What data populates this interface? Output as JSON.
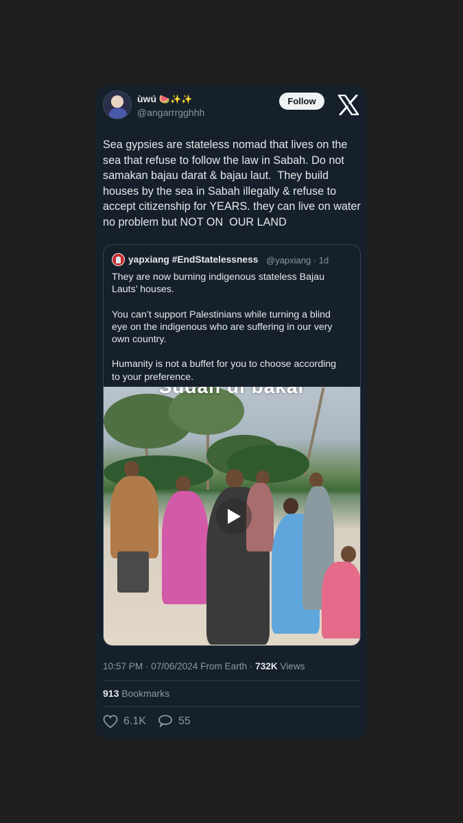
{
  "author": {
    "display_name": "ùwú",
    "display_emoji": "🍉✨✨",
    "handle": "@angarrrgghhh"
  },
  "follow_label": "Follow",
  "tweet_text": "Sea gypsies are stateless nomad that lives on the\nsea that refuse to follow the law in Sabah. Do not\nsamakan bajau darat & bajau laut.  They build\nhouses by the sea in Sabah illegally & refuse to\naccept citizenship for YEARS. they can live on water\nno problem but NOT ON  OUR LAND",
  "quoted": {
    "name": "yapxiang #EndStatelessness",
    "meta": "@yapxiang · 1d",
    "text": "They are now burning indigenous stateless Bajau\nLauts’ houses.\n\nYou can’t support Palestinians while turning a blind\neye on the indigenous who are suffering in our very\nown country.\n\nHumanity is not a buffet for you to choose according\nto your preference.",
    "video_overlay_text": "Sudah di bakar"
  },
  "timestamp": {
    "text": "10:57 PM · 07/06/2024 From Earth · ",
    "views_count": "732K",
    "views_label": " Views"
  },
  "bookmarks": {
    "count": "913",
    "label": " Bookmarks"
  },
  "actions": {
    "likes": "6.1K",
    "replies": "55"
  },
  "colors": {
    "background": "#1f1f1f",
    "card": "#15202b",
    "text": "#e7e9ea",
    "muted": "#8b98a5",
    "border": "#38444d"
  },
  "icons": [
    "x-logo-icon",
    "heart-icon",
    "reply-icon",
    "play-icon"
  ]
}
